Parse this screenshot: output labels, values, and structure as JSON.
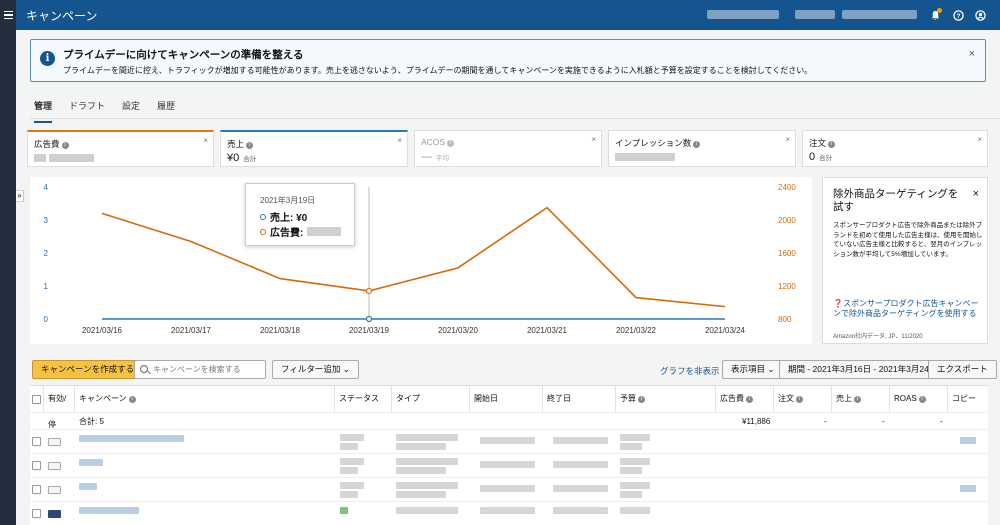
{
  "header": {
    "title": "キャンペーン"
  },
  "banner": {
    "title": "プライムデーに向けてキャンペーンの準備を整える",
    "text": "プライムデーを間近に控え、トラフィックが増加する可能性があります。売上を逃さないよう、プライムデーの期間を通してキャンペーンを実施できるように入札額と予算を設定することを検討してください。",
    "close": "×"
  },
  "tabs": [
    {
      "label": "管理",
      "active": true
    },
    {
      "label": "ドラフト"
    },
    {
      "label": "設定"
    },
    {
      "label": "履歴"
    }
  ],
  "metrics": [
    {
      "label": "広告費",
      "value": "",
      "sub": "",
      "color": "#e47911"
    },
    {
      "label": "売上",
      "value": "¥0",
      "sub": "合計",
      "color": "#1f77b4"
    },
    {
      "label": "ACOS",
      "value": "—",
      "sub": "平均",
      "color": ""
    },
    {
      "label": "インプレッション数",
      "value": "",
      "sub": "",
      "color": ""
    },
    {
      "label": "注文",
      "value": "0",
      "sub": "合計",
      "color": ""
    }
  ],
  "tooltip": {
    "date": "2021年3月19日",
    "sales_label": "売上: ¥0",
    "spend_label": "広告費:"
  },
  "chart_data": {
    "type": "line",
    "x": [
      "2021/03/16",
      "2021/03/17",
      "2021/03/18",
      "2021/03/19",
      "2021/03/20",
      "2021/03/21",
      "2021/03/22",
      "2021/03/24"
    ],
    "left_axis": {
      "ticks": [
        "0",
        "1",
        "2",
        "3",
        "4"
      ],
      "ylim": [
        0,
        4
      ]
    },
    "right_axis": {
      "ticks": [
        "800",
        "1200",
        "1600",
        "2000",
        "2400"
      ],
      "ylim": [
        800,
        2400
      ]
    },
    "series": [
      {
        "name": "売上",
        "axis": "left",
        "color": "#2a7ab8",
        "values": [
          0,
          0,
          0,
          0,
          0,
          0,
          0,
          0
        ]
      },
      {
        "name": "広告費",
        "axis": "right",
        "color": "#d46b08",
        "values": [
          2080,
          1740,
          1290,
          1140,
          1420,
          2150,
          1060,
          950
        ]
      }
    ],
    "highlight_index": 3
  },
  "promo": {
    "title": "除外商品ターゲティングを試す",
    "body": "スポンサープロダクト広告で除外商品または除外ブランドを初めて使用した広告主様は、使用を開始していない広告主様と比較すると、翌月のインプレッション数が平均して5%増加しています。",
    "link": "スポンサープロダクト広告キャンペーンで除外商品ターゲティングを使用する",
    "source": "Amazon社内データ, JP、11/2020",
    "close": "×"
  },
  "toolbar": {
    "create": "キャンペーンを作成する",
    "search_placeholder": "キャンペーンを検索する",
    "filter": "フィルター追加 ⌄",
    "hide_graph": "グラフを非表示",
    "columns": "表示項目 ⌄",
    "period": "期間 - 2021年3月16日 - 2021年3月24日",
    "export": "エクスポート"
  },
  "table": {
    "headers": [
      "有効/停",
      "キャンペーン",
      "ステータス",
      "タイプ",
      "開始日",
      "終了日",
      "予算",
      "広告費",
      "注文",
      "売上",
      "ROAS",
      "コピー"
    ],
    "total_label": "合計: 5",
    "total_spend": "¥11,886",
    "total_dash": "-"
  }
}
